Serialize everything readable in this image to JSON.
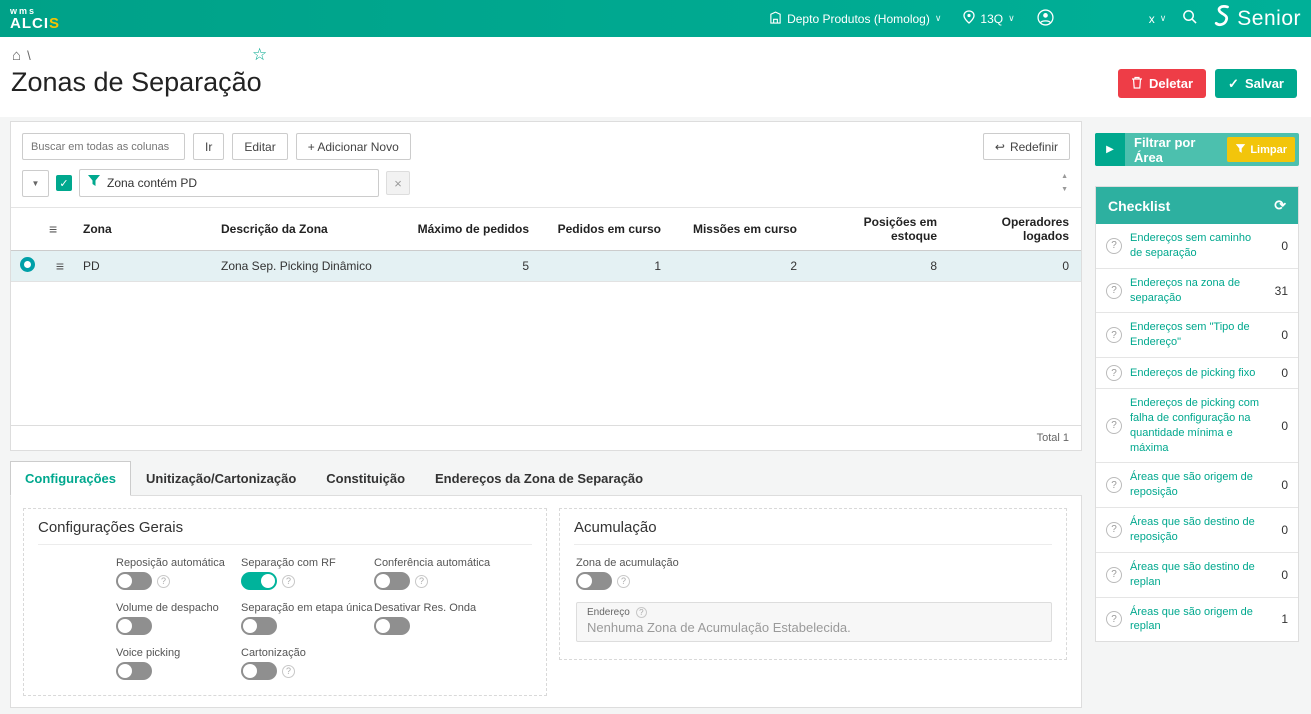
{
  "colors": {
    "accent": "#00a88e",
    "accent_light": "#4cc0ae",
    "yellow": "#f2c50b",
    "red": "#ee3d47",
    "row_highlight": "#e4f1f3"
  },
  "icons": {
    "home": "⌂",
    "star": "☆",
    "chevron": "∨",
    "caret": "▼",
    "up": "▲",
    "down": "▼",
    "hamburger": "≡",
    "close": "×",
    "check": "✓",
    "play": "▶",
    "refresh": "⟳",
    "reset": "↩",
    "question": "?"
  },
  "topbar": {
    "logo_top": "wms",
    "logo_main": "ALCI",
    "logo_accent": "S",
    "depot": "Depto Produtos (Homolog)",
    "warehouse": "13Q",
    "lang": "x",
    "brand": "Senior"
  },
  "breadcrumb": {
    "separator": "\\"
  },
  "header": {
    "title": "Zonas de Separação",
    "delete_label": "Deletar",
    "save_label": "Salvar"
  },
  "toolbar": {
    "search_placeholder": "Buscar em todas as colunas",
    "go_label": "Ir",
    "edit_label": "Editar",
    "add_label": "+ Adicionar Novo",
    "reset_label": "Redefinir"
  },
  "filter": {
    "enabled": true,
    "value": "Zona contém PD"
  },
  "table": {
    "columns": [
      "Zona",
      "Descrição da Zona",
      "Máximo de pedidos",
      "Pedidos em curso",
      "Missões em curso",
      "Posições em estoque",
      "Operadores logados"
    ],
    "rows": [
      {
        "selected": true,
        "zona": "PD",
        "descricao": "Zona Sep. Picking Dinâmico",
        "maximo": "5",
        "pedidos": "1",
        "missoes": "2",
        "posicoes": "8",
        "operadores": "0"
      }
    ],
    "total_label": "Total 1"
  },
  "tabs": [
    {
      "label": "Configurações",
      "active": true
    },
    {
      "label": "Unitização/Cartonização"
    },
    {
      "label": "Constituição"
    },
    {
      "label": "Endereços da Zona de Separação"
    }
  ],
  "config": {
    "general_title": "Configurações Gerais",
    "toggles": [
      {
        "label": "Reposição automática",
        "on": false
      },
      {
        "label": "Separação com RF",
        "on": true
      },
      {
        "label": "Conferência automática",
        "on": false
      },
      {
        "label": "Volume de despacho",
        "on": false
      },
      {
        "label": "Separação em etapa única",
        "on": false
      },
      {
        "label": "Desativar Res. Onda",
        "on": false
      },
      {
        "label": "Voice picking",
        "on": false
      },
      {
        "label": "Cartonização",
        "on": false
      }
    ],
    "accumulation": {
      "title": "Acumulação",
      "toggle_label": "Zona de acumulação",
      "on": false,
      "address_label": "Endereço",
      "address_value": "Nenhuma Zona de Acumulação Estabelecida."
    }
  },
  "sidebar": {
    "filter_area_label": "Filtrar por Área",
    "clear_label": "Limpar",
    "checklist_title": "Checklist",
    "items": [
      {
        "label": "Endereços sem caminho de separação",
        "count": "0"
      },
      {
        "label": "Endereços na zona de separação",
        "count": "31"
      },
      {
        "label": "Endereços sem \"Tipo de Endereço\"",
        "count": "0"
      },
      {
        "label": "Endereços de picking fixo",
        "count": "0"
      },
      {
        "label": "Endereços de picking com falha de configuração na quantidade mínima e máxima",
        "count": "0"
      },
      {
        "label": "Áreas que são origem de reposição",
        "count": "0"
      },
      {
        "label": "Áreas que são destino de reposição",
        "count": "0"
      },
      {
        "label": "Áreas que são destino de replan",
        "count": "0"
      },
      {
        "label": "Áreas que são origem de replan",
        "count": "1"
      }
    ]
  }
}
